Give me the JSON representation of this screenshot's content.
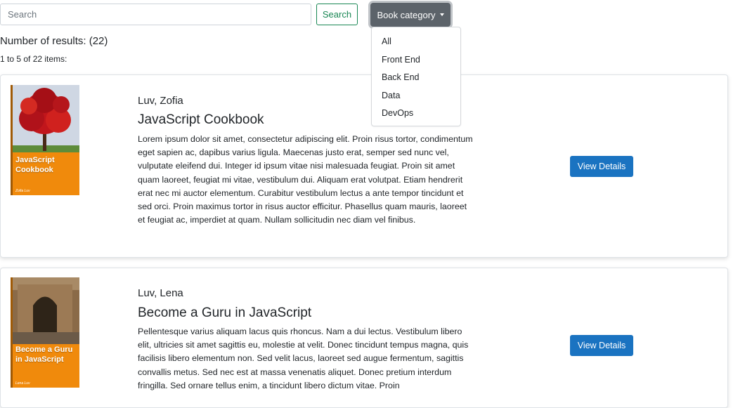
{
  "search": {
    "placeholder": "Search",
    "button_label": "Search"
  },
  "category": {
    "button_label": "Book category",
    "options": [
      "All",
      "Front End",
      "Back End",
      "Data",
      "DevOps"
    ]
  },
  "results": {
    "count_text": "Number of results: (22)",
    "range_text": "1 to 5 of 22 items:"
  },
  "books": [
    {
      "author": "Luv, Zofia",
      "title": "JavaScript Cookbook",
      "description": "Lorem ipsum dolor sit amet, consectetur adipiscing elit. Proin risus tortor, condimentum eget sapien ac, dapibus varius ligula. Maecenas justo erat, semper sed nunc vel, vulputate eleifend dui. Integer id ipsum vitae nisi malesuada feugiat. Proin sit amet quam laoreet, feugiat mi vitae, vestibulum dui. Aliquam erat volutpat. Etiam hendrerit erat nec mi auctor elementum. Curabitur vestibulum lectus a ante tempor tincidunt et sed orci. Proin maximus tortor in risus auctor efficitur. Phasellus quam mauris, laoreet et feugiat ac, imperdiet at quam. Nullam sollicitudin nec diam vel finibus.",
      "cover_title": "JavaScript Cookbook",
      "cover_author": "Zofia Luv",
      "button_label": "View Details"
    },
    {
      "author": "Luv, Lena",
      "title": "Become a Guru in JavaScript",
      "description": "Pellentesque varius aliquam lacus quis rhoncus. Nam a dui lectus. Vestibulum libero elit, ultricies sit amet sagittis eu, molestie at velit. Donec tincidunt tempus magna, quis facilisis libero elementum non. Sed velit lacus, laoreet sed augue fermentum, sagittis convallis metus. Sed nec est at massa venenatis aliquet. Donec pretium interdum fringilla. Sed ornare tellus enim, a tincidunt libero dictum vitae. Proin",
      "cover_title": "Become a Guru in JavaScript",
      "cover_author": "Lena Luv",
      "button_label": "View Details"
    }
  ],
  "colors": {
    "search_button": "#198754",
    "category_button": "#5c636a",
    "view_button": "#1a73c1",
    "cover_orange": "#f08a0c"
  }
}
